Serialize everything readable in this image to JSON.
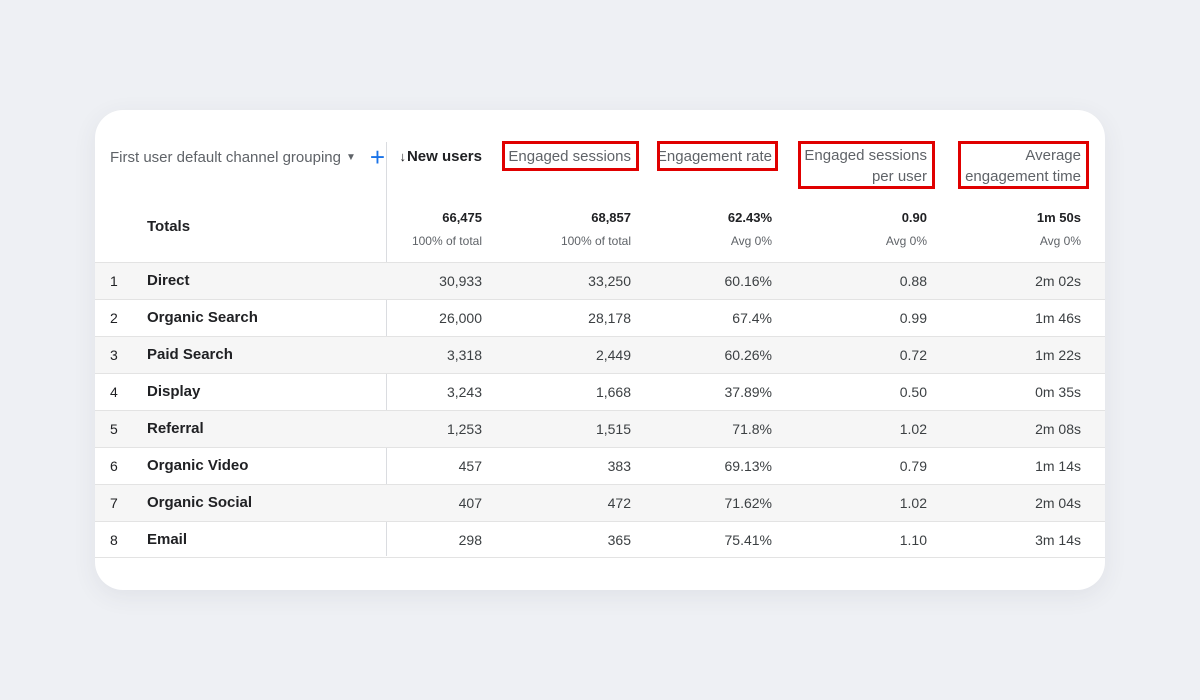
{
  "dimension": {
    "label": "First user default channel grouping",
    "caret_icon": "dropdown-caret-icon",
    "add_icon": "plus-icon"
  },
  "columns": {
    "new_users": "New users",
    "sort_icon": "sort-descending-arrow-icon",
    "engaged_sessions": "Engaged sessions",
    "engagement_rate": "Engagement rate",
    "sessions_per_user_line1": "Engaged sessions",
    "sessions_per_user_line2": "per user",
    "avg_time_line1": "Average",
    "avg_time_line2": "engagement time"
  },
  "totals": {
    "label": "Totals",
    "new_users": "66,475",
    "new_users_sub": "100% of total",
    "engaged_sessions": "68,857",
    "engaged_sessions_sub": "100% of total",
    "engagement_rate": "62.43%",
    "engagement_rate_sub": "Avg 0%",
    "sessions_per_user": "0.90",
    "sessions_per_user_sub": "Avg 0%",
    "avg_time": "1m 50s",
    "avg_time_sub": "Avg 0%"
  },
  "rows": [
    {
      "idx": "1",
      "name": "Direct",
      "new_users": "30,933",
      "engaged_sessions": "33,250",
      "engagement_rate": "60.16%",
      "sessions_per_user": "0.88",
      "avg_time": "2m 02s"
    },
    {
      "idx": "2",
      "name": "Organic Search",
      "new_users": "26,000",
      "engaged_sessions": "28,178",
      "engagement_rate": "67.4%",
      "sessions_per_user": "0.99",
      "avg_time": "1m 46s"
    },
    {
      "idx": "3",
      "name": "Paid Search",
      "new_users": "3,318",
      "engaged_sessions": "2,449",
      "engagement_rate": "60.26%",
      "sessions_per_user": "0.72",
      "avg_time": "1m 22s"
    },
    {
      "idx": "4",
      "name": "Display",
      "new_users": "3,243",
      "engaged_sessions": "1,668",
      "engagement_rate": "37.89%",
      "sessions_per_user": "0.50",
      "avg_time": "0m 35s"
    },
    {
      "idx": "5",
      "name": "Referral",
      "new_users": "1,253",
      "engaged_sessions": "1,515",
      "engagement_rate": "71.8%",
      "sessions_per_user": "1.02",
      "avg_time": "2m 08s"
    },
    {
      "idx": "6",
      "name": "Organic Video",
      "new_users": "457",
      "engaged_sessions": "383",
      "engagement_rate": "69.13%",
      "sessions_per_user": "0.79",
      "avg_time": "1m 14s"
    },
    {
      "idx": "7",
      "name": "Organic Social",
      "new_users": "407",
      "engaged_sessions": "472",
      "engagement_rate": "71.62%",
      "sessions_per_user": "1.02",
      "avg_time": "2m 04s"
    },
    {
      "idx": "8",
      "name": "Email",
      "new_users": "298",
      "engaged_sessions": "365",
      "engagement_rate": "75.41%",
      "sessions_per_user": "1.10",
      "avg_time": "3m 14s"
    }
  ],
  "colors": {
    "accent": "#1a73e8",
    "highlight_box": "#e00000",
    "row_shade": "#f6f6f6",
    "background": "#eef0f4"
  }
}
